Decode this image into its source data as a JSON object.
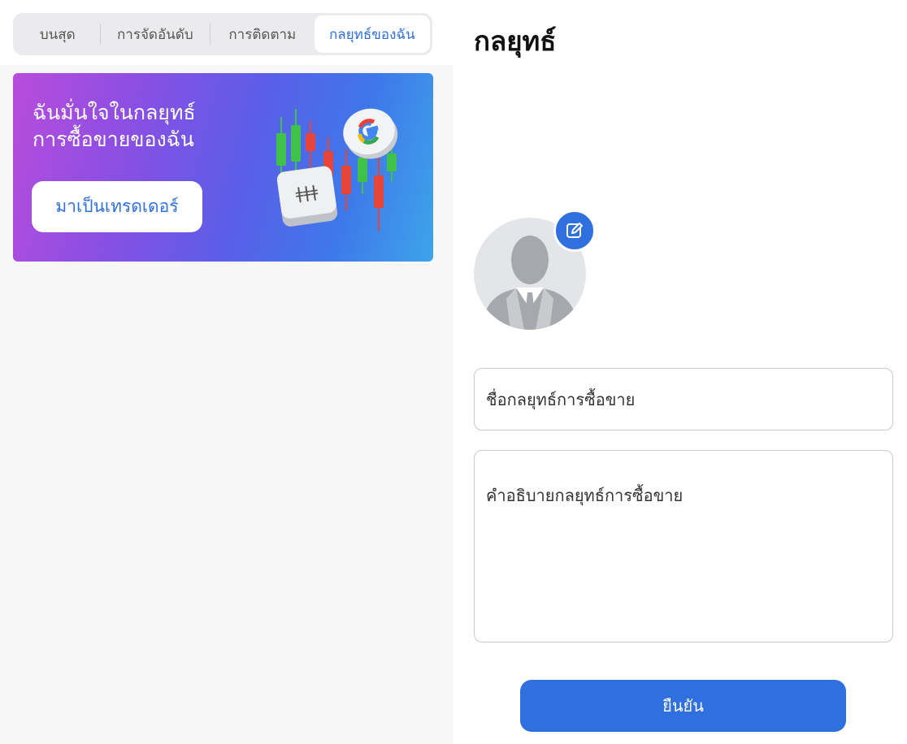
{
  "tabs": [
    {
      "label": "บนสุด",
      "active": false
    },
    {
      "label": "การจัดอันดับ",
      "active": false
    },
    {
      "label": "การติดตาม",
      "active": false
    },
    {
      "label": "กลยุทธ์ของฉัน",
      "active": true
    }
  ],
  "banner": {
    "line1": "ฉันมั่นใจในกลยุทธ์",
    "line2": "การซื้อขายของฉัน",
    "button_label": "มาเป็นเทรดเดอร์"
  },
  "form": {
    "title": "กลยุทธ์",
    "name_placeholder": "ชื่อกลยุทธ์การซื้อขาย",
    "description_placeholder": "คำอธิบายกลยุทธ์การซื้อขาย",
    "confirm_label": "ยืนยัน"
  },
  "colors": {
    "accent": "#2f6fde",
    "candle_green": "#3fc24a",
    "candle_red": "#e8453a"
  },
  "icons": {
    "edit": "edit-pencil-icon",
    "avatar": "user-avatar-placeholder",
    "banner_art": "candlestick-chart-with-google-coin-illustration"
  }
}
